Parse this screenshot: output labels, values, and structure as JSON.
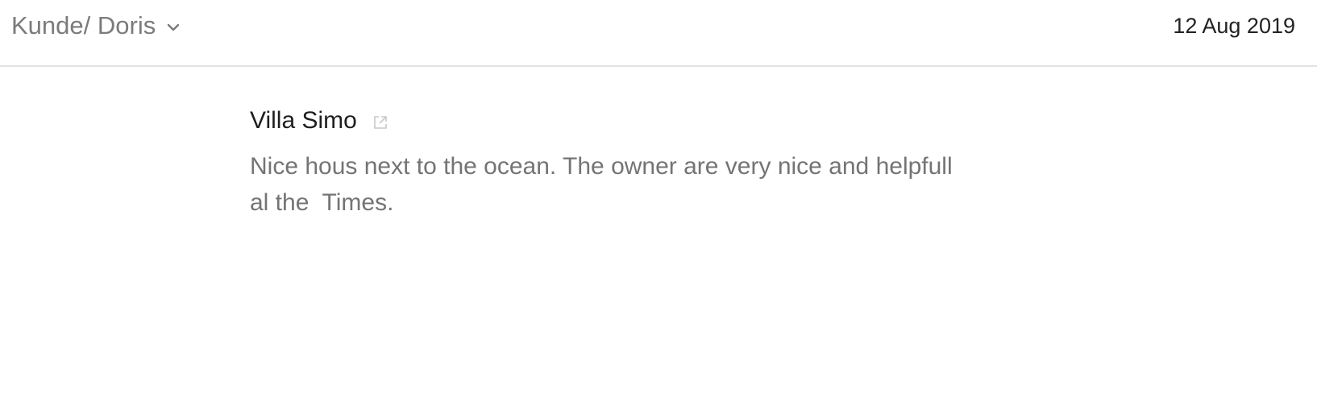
{
  "header": {
    "selector_label": "Kunde/ Doris",
    "selector_icon": "chevron-down-icon",
    "date": "12 Aug 2019"
  },
  "review": {
    "title": "Villa Simo",
    "title_icon": "external-link-icon",
    "body": "Nice hous next to the ocean. The owner are very nice and helpfull al the  Times."
  },
  "colors": {
    "muted_text": "#747474",
    "title_text": "#1e1e1e",
    "divider": "#e2e2e2",
    "icon": "#c8c8c8"
  }
}
